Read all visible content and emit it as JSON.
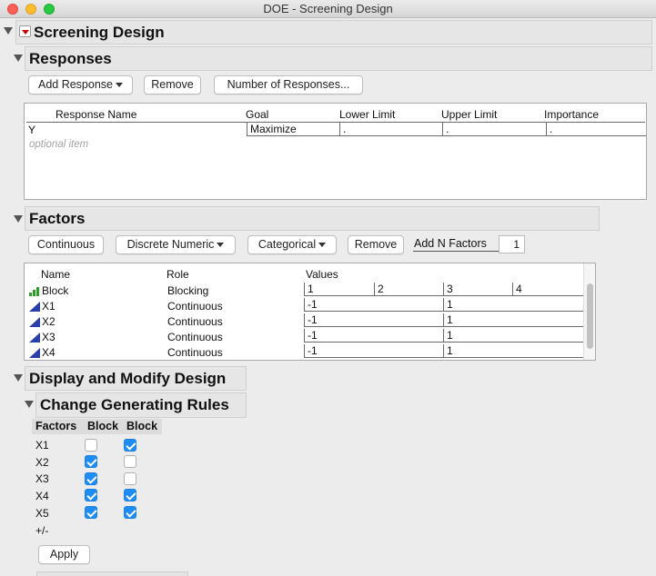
{
  "window": {
    "title": "DOE - Screening Design"
  },
  "screening": {
    "title": "Screening Design"
  },
  "responses": {
    "title": "Responses",
    "add_response": "Add Response",
    "remove": "Remove",
    "number_of_responses": "Number of Responses...",
    "columns": [
      "Response Name",
      "Goal",
      "Lower Limit",
      "Upper Limit",
      "Importance"
    ],
    "rows": [
      {
        "name": "Y",
        "goal": "Maximize",
        "lower": ".",
        "upper": ".",
        "importance": "."
      }
    ],
    "optional_item": "optional item"
  },
  "factors": {
    "title": "Factors",
    "continuous": "Continuous",
    "discrete_numeric": "Discrete Numeric",
    "categorical": "Categorical",
    "remove": "Remove",
    "add_n_factors": "Add N Factors",
    "n_value": "1",
    "columns": [
      "Name",
      "Role",
      "Values"
    ],
    "rows": [
      {
        "name": "Block",
        "role": "Blocking",
        "values": [
          "1",
          "2",
          "3",
          "4"
        ],
        "icon": "blocking-icon"
      },
      {
        "name": "X1",
        "role": "Continuous",
        "values": [
          "-1",
          "1"
        ],
        "icon": "continuous-icon"
      },
      {
        "name": "X2",
        "role": "Continuous",
        "values": [
          "-1",
          "1"
        ],
        "icon": "continuous-icon"
      },
      {
        "name": "X3",
        "role": "Continuous",
        "values": [
          "-1",
          "1"
        ],
        "icon": "continuous-icon"
      },
      {
        "name": "X4",
        "role": "Continuous",
        "values": [
          "-1",
          "1"
        ],
        "icon": "continuous-icon"
      }
    ]
  },
  "display_modify": {
    "title": "Display and Modify Design"
  },
  "generating_rules": {
    "title": "Change Generating Rules",
    "columns": [
      "Factors",
      "Block",
      "Block"
    ],
    "rows": [
      {
        "factor": "X1",
        "checks": [
          false,
          true
        ]
      },
      {
        "factor": "X2",
        "checks": [
          true,
          false
        ]
      },
      {
        "factor": "X3",
        "checks": [
          true,
          false
        ]
      },
      {
        "factor": "X4",
        "checks": [
          true,
          true
        ]
      },
      {
        "factor": "X5",
        "checks": [
          true,
          true
        ]
      }
    ],
    "plus_minus": "+/-",
    "apply": "Apply"
  },
  "colors": {
    "accent": "#1d8cf5",
    "menu_red": "#d00000"
  }
}
